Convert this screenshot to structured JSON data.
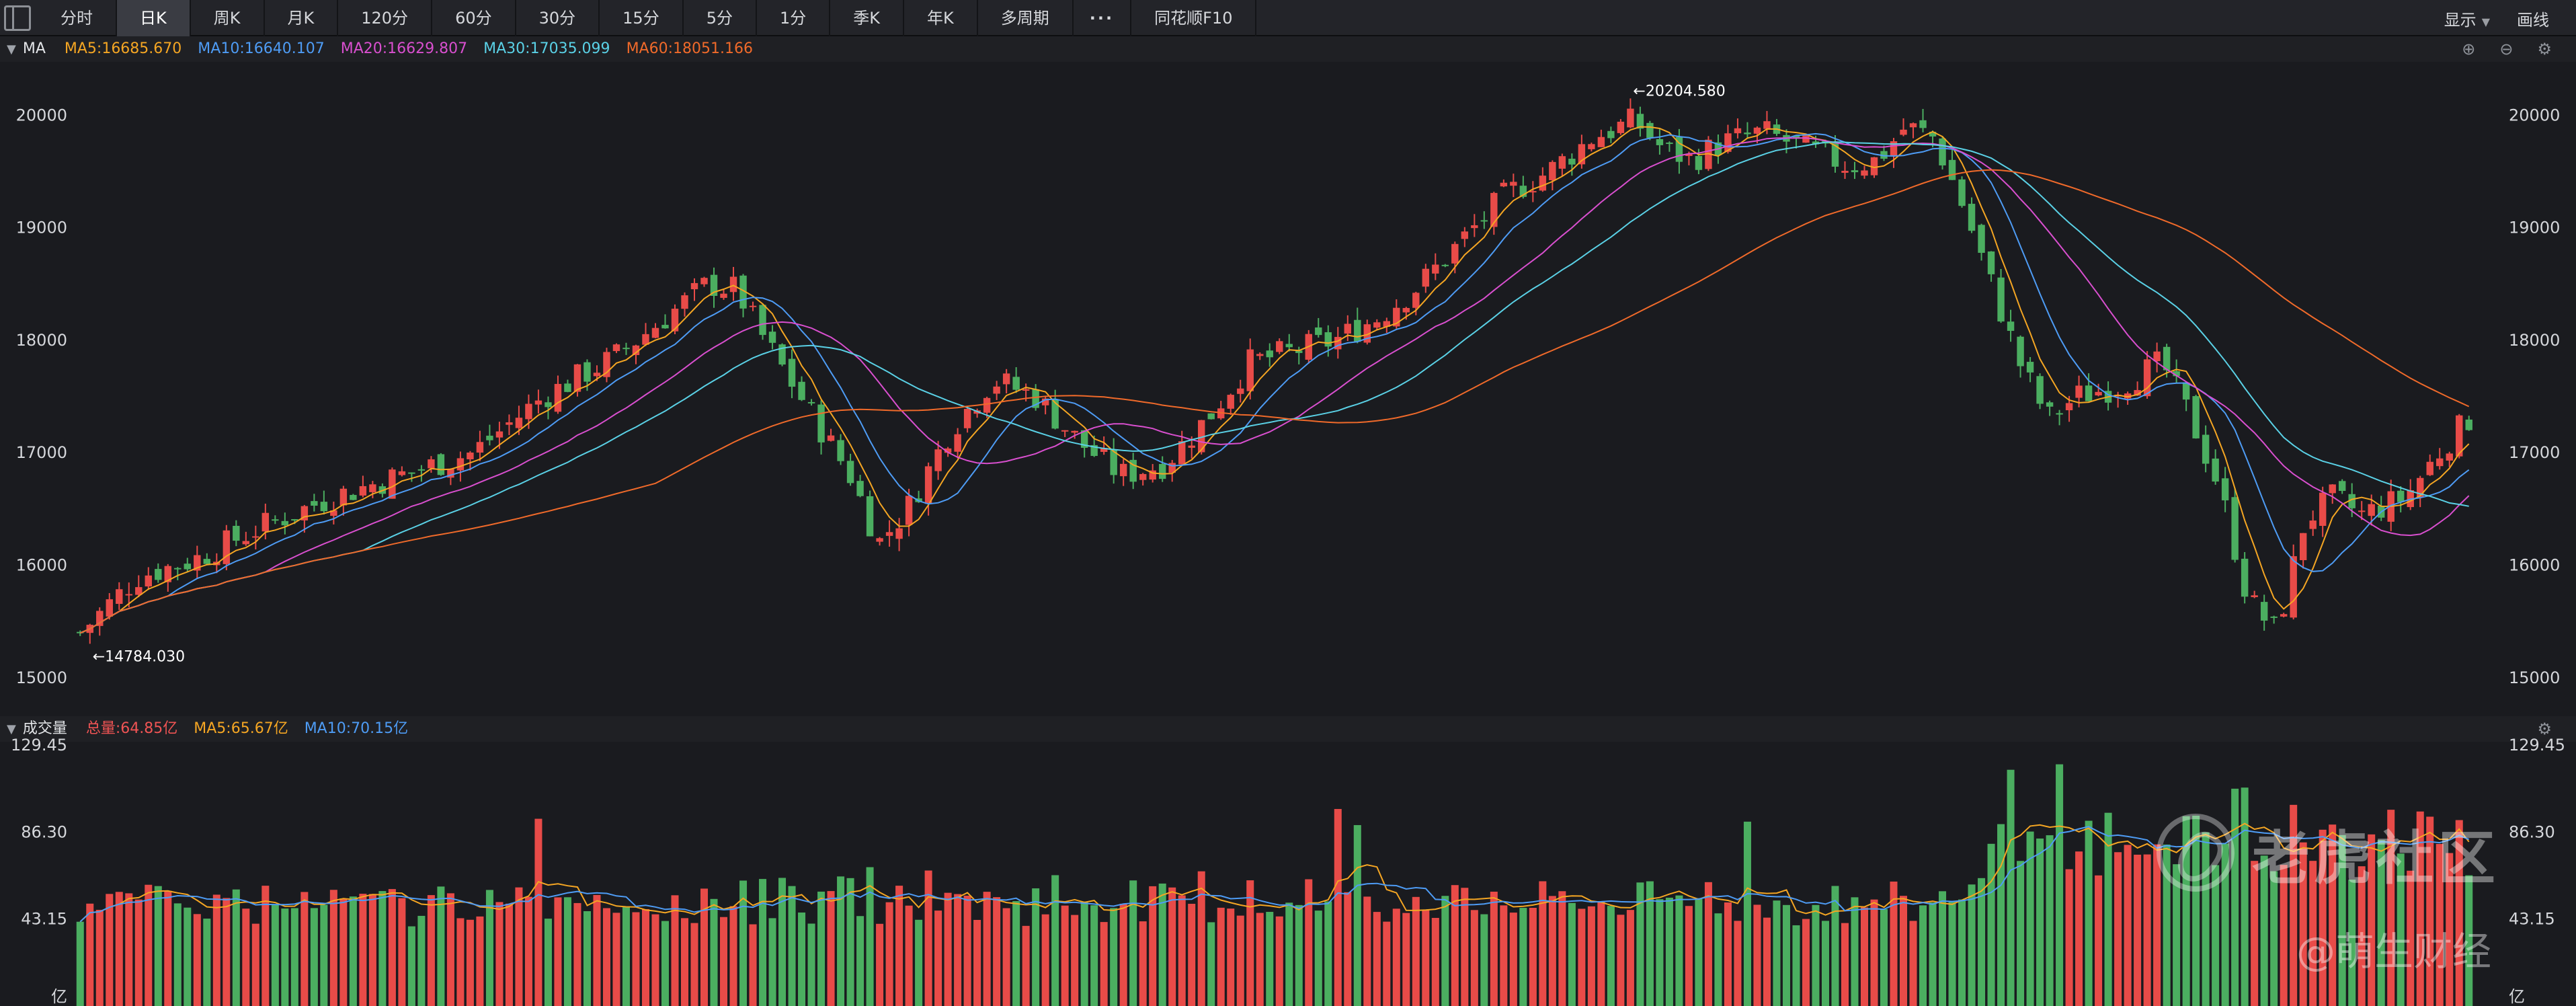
{
  "toolbar": {
    "tabs": [
      {
        "label": "分时"
      },
      {
        "label": "日K"
      },
      {
        "label": "周K"
      },
      {
        "label": "月K"
      },
      {
        "label": "120分"
      },
      {
        "label": "60分"
      },
      {
        "label": "30分"
      },
      {
        "label": "15分"
      },
      {
        "label": "5分"
      },
      {
        "label": "1分"
      },
      {
        "label": "季K"
      },
      {
        "label": "年K"
      },
      {
        "label": "多周期"
      },
      {
        "label": "···"
      },
      {
        "label": "同花顺F10"
      }
    ],
    "active_tab": "日K",
    "display_label": "显示",
    "draw_label": "画线"
  },
  "price_panel": {
    "title": "MA",
    "legend": [
      {
        "label": "MA5:16685.670",
        "color": "#f5a623"
      },
      {
        "label": "MA10:16640.107",
        "color": "#4e9cf5"
      },
      {
        "label": "MA20:16629.807",
        "color": "#d94fcf"
      },
      {
        "label": "MA30:17035.099",
        "color": "#5ad1e6"
      },
      {
        "label": "MA60:18051.166",
        "color": "#f06a2a"
      }
    ],
    "high_marker": "←20204.580",
    "low_marker": "←14784.030"
  },
  "volume_panel": {
    "title": "成交量",
    "legend": [
      {
        "label": "总量:64.85亿",
        "color": "#f05454"
      },
      {
        "label": "MA5:65.67亿",
        "color": "#f5a623"
      },
      {
        "label": "MA10:70.15亿",
        "color": "#4e9cf5"
      }
    ],
    "unit": "亿"
  },
  "colors": {
    "up": "#e84b48",
    "down": "#4bae60",
    "background": "#1a1b1f"
  },
  "watermark": {
    "brand": "老虎社区",
    "author": "@萌生财经"
  },
  "chart_data": [
    {
      "type": "candlestick",
      "y_ticks": [
        15000,
        16000,
        17000,
        18000,
        19000,
        20000
      ],
      "ylim": [
        14700,
        20450
      ],
      "grid": false,
      "candle_count": 246,
      "close_path": [
        [
          0,
          15400
        ],
        [
          8,
          15900
        ],
        [
          16,
          16050
        ],
        [
          24,
          16300
        ],
        [
          35,
          16600
        ],
        [
          45,
          16800
        ],
        [
          55,
          17000
        ],
        [
          65,
          17500
        ],
        [
          75,
          17850
        ],
        [
          82,
          18200
        ],
        [
          88,
          18500
        ],
        [
          92,
          18450
        ],
        [
          96,
          18000
        ],
        [
          102,
          17400
        ],
        [
          108,
          16800
        ],
        [
          112,
          16200
        ],
        [
          116,
          16500
        ],
        [
          122,
          17200
        ],
        [
          128,
          17650
        ],
        [
          134,
          17500
        ],
        [
          140,
          17100
        ],
        [
          146,
          16800
        ],
        [
          152,
          16900
        ],
        [
          158,
          17300
        ],
        [
          164,
          17800
        ],
        [
          170,
          17900
        ],
        [
          176,
          18000
        ],
        [
          182,
          18200
        ],
        [
          188,
          18500
        ],
        [
          194,
          18900
        ],
        [
          200,
          19300
        ],
        [
          206,
          19500
        ],
        [
          212,
          19800
        ],
        [
          218,
          19950
        ],
        [
          222,
          19700
        ],
        [
          226,
          19600
        ],
        [
          230,
          19750
        ],
        [
          236,
          19850
        ],
        [
          242,
          19700
        ],
        [
          248,
          19550
        ],
        [
          252,
          19600
        ],
        [
          256,
          19900
        ],
        [
          260,
          19800
        ],
        [
          264,
          19200
        ],
        [
          268,
          18500
        ],
        [
          272,
          17800
        ],
        [
          276,
          17300
        ],
        [
          280,
          17500
        ],
        [
          286,
          17600
        ],
        [
          292,
          17800
        ],
        [
          296,
          17300
        ],
        [
          300,
          16700
        ],
        [
          304,
          15700
        ],
        [
          308,
          15400
        ],
        [
          312,
          16400
        ],
        [
          316,
          16600
        ],
        [
          320,
          16450
        ],
        [
          326,
          16600
        ],
        [
          332,
          17100
        ],
        [
          335,
          17300
        ]
      ],
      "ma5_last": 16685.67,
      "ma10_last": 16640.107,
      "ma20_last": 16629.807,
      "ma30_last": 17035.099,
      "ma60_last": 18051.166,
      "high_label": 20204.58,
      "low_label": 14784.03
    },
    {
      "type": "bar",
      "y_ticks": [
        43.15,
        86.3,
        129.45
      ],
      "ylim": [
        0,
        129.45
      ],
      "unit": "亿",
      "bar_count": 246,
      "last_volume": 64.85,
      "ma5_last": 65.67,
      "ma10_last": 70.15
    }
  ]
}
